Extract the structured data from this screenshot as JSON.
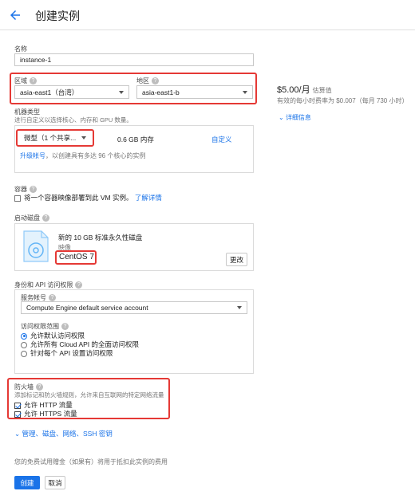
{
  "header": {
    "title": "创建实例"
  },
  "name_section": {
    "label": "名称",
    "value": "instance-1"
  },
  "region_section": {
    "region_label": "区域",
    "region_value": "asia-east1（台湾）",
    "zone_label": "地区",
    "zone_value": "asia-east1-b"
  },
  "pricing": {
    "price": "$5.00/月",
    "estimate_label": "估算值",
    "effective_rate": "有效的每小时费率为 $0.007（每月 730 小时）",
    "details_link": "详细信息"
  },
  "machine_type": {
    "label": "机器类型",
    "description": "进行自定义以选择核心、内存和 GPU 数量。",
    "selected": "微型（1 个共享...",
    "memory": "0.6 GB 内存",
    "customize_link": "自定义",
    "upgrade_link": "升级帐号",
    "upgrade_text": "，以创建具有多达 96 个核心的实例"
  },
  "container": {
    "label": "容器",
    "checkbox_label": "将一个容器映像部署到此 VM 实例。",
    "learn_more_link": "了解详情"
  },
  "boot_disk": {
    "label": "启动磁盘",
    "disk_title": "新的 10 GB 标准永久性磁盘",
    "image_label": "映像",
    "image_value": "CentOS 7",
    "change_button": "更改"
  },
  "identity": {
    "label": "身份和 API 访问权限",
    "service_account_label": "服务帐号",
    "service_account_value": "Compute Engine default service account",
    "access_scope_label": "访问权限范围",
    "options": [
      {
        "label": "允许默认访问权限",
        "selected": true
      },
      {
        "label": "允许所有 Cloud API 的全面访问权限",
        "selected": false
      },
      {
        "label": "针对每个 API 设置访问权限",
        "selected": false
      }
    ]
  },
  "firewall": {
    "label": "防火墙",
    "description": "添加标记和防火墙规则，允许来自互联网的特定网络流量",
    "http_label": "允许 HTTP 流量",
    "https_label": "允许 HTTPS 流量",
    "http_checked": true,
    "https_checked": true
  },
  "advanced_link": "管理、磁盘、网络、SSH 密钥",
  "footer": {
    "free_trial_text": "您的免费试用赠金（如果有）将用于抵扣此实例的费用",
    "create_button": "创建",
    "cancel_button": "取消"
  },
  "colors": {
    "accent": "#1a73e8",
    "highlight": "#e53935"
  }
}
